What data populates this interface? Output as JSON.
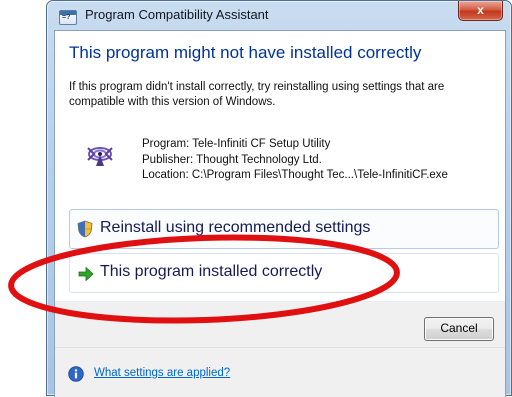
{
  "window": {
    "title": "Program Compatibility Assistant",
    "close_glyph": "x"
  },
  "dialog": {
    "heading": "This program might not have installed correctly",
    "description": "If this program didn't install correctly, try reinstalling using settings that are compatible with this version of Windows."
  },
  "program_info": {
    "icon": "tele-infiniti-icon",
    "program": "Program: Tele-Infiniti CF Setup Utility",
    "publisher": "Publisher: Thought Technology Ltd.",
    "location": "Location: C:\\Program Files\\Thought Tec...\\Tele-InfinitiCF.exe"
  },
  "options": [
    {
      "icon": "shield-icon",
      "label": "Reinstall using recommended settings"
    },
    {
      "icon": "green-arrow-icon",
      "label": "This program installed correctly"
    }
  ],
  "buttons": {
    "cancel": "Cancel"
  },
  "footer": {
    "icon": "info-icon",
    "link": "What settings are applied?"
  },
  "annotation": {
    "shape": "ellipse",
    "color": "#e01010"
  },
  "colors": {
    "heading": "#003399",
    "option_text": "#151c55",
    "link": "#0066cc"
  }
}
